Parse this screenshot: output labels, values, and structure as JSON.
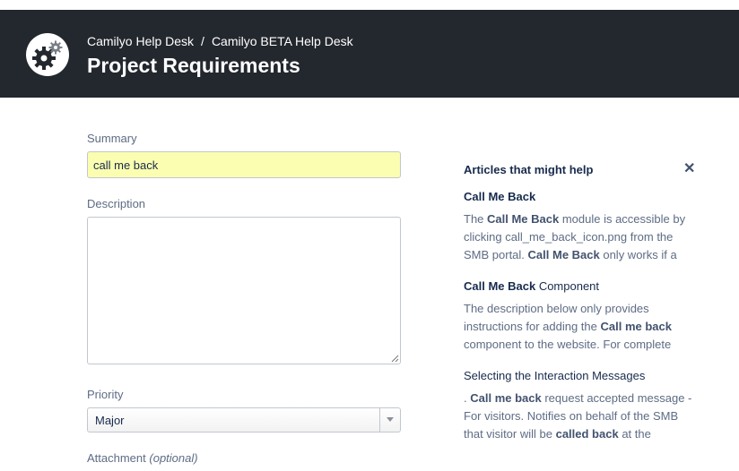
{
  "header": {
    "breadcrumb": [
      "Camilyo Help Desk",
      "Camilyo BETA Help Desk"
    ],
    "breadcrumb_separator": "/",
    "title": "Project Requirements",
    "logo_icon": "gears-icon",
    "background_color": "#23272e"
  },
  "form": {
    "summary_label": "Summary",
    "summary_value": "call me back",
    "description_label": "Description",
    "description_value": "",
    "priority_label": "Priority",
    "priority_value": "Major",
    "attachment_label": "Attachment",
    "attachment_optional": "(optional)"
  },
  "help_panel": {
    "title": "Articles that might help",
    "close_icon": "close-icon",
    "articles": [
      {
        "title_bold": "Call Me Back",
        "title_rest": "",
        "body": [
          {
            "t": "The ",
            "b": false
          },
          {
            "t": "Call Me Back",
            "b": true
          },
          {
            "t": " module is accessible by clicking call_me_back_icon.png from the SMB portal. ",
            "b": false
          },
          {
            "t": "Call Me Back",
            "b": true
          },
          {
            "t": " only works if a",
            "b": false
          }
        ]
      },
      {
        "title_bold": "Call Me Back",
        "title_rest": " Component",
        "body": [
          {
            "t": "The description below only provides instructions for adding the ",
            "b": false
          },
          {
            "t": "Call me back",
            "b": true
          },
          {
            "t": " component to the website. For complete",
            "b": false
          }
        ]
      },
      {
        "title_bold": "",
        "title_rest": "Selecting the Interaction Messages",
        "body": [
          {
            "t": ". ",
            "b": false
          },
          {
            "t": "Call me back",
            "b": true
          },
          {
            "t": " request accepted message - For visitors. Notifies on behalf of the SMB that visitor will be ",
            "b": false
          },
          {
            "t": "called back",
            "b": true
          },
          {
            "t": " at the",
            "b": false
          }
        ]
      }
    ]
  }
}
